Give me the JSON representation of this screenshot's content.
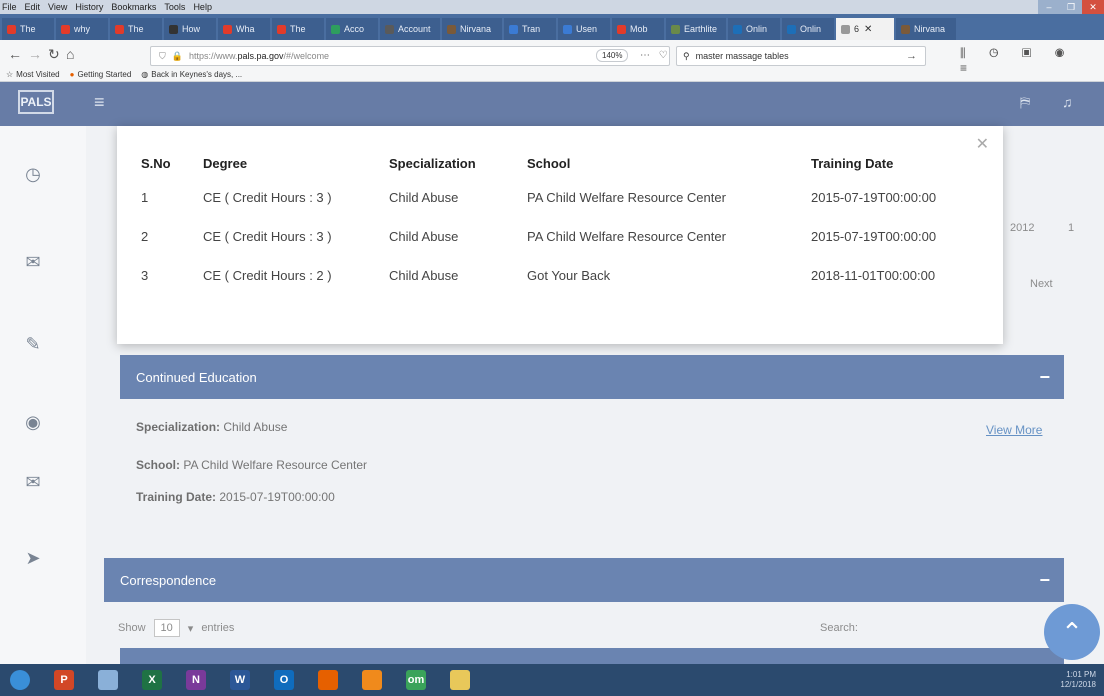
{
  "browser": {
    "menu": [
      "File",
      "Edit",
      "View",
      "History",
      "Bookmarks",
      "Tools",
      "Help"
    ],
    "tabs": [
      {
        "label": "The",
        "color": "#e23b2a"
      },
      {
        "label": "why",
        "color": "#e23b2a"
      },
      {
        "label": "The",
        "color": "#e23b2a"
      },
      {
        "label": "How",
        "color": "#333333"
      },
      {
        "label": "Wha",
        "color": "#e23b2a"
      },
      {
        "label": "The",
        "color": "#e23b2a"
      },
      {
        "label": "Acco",
        "color": "#2e9e5e"
      },
      {
        "label": "Account",
        "color": "#5a5a5a"
      },
      {
        "label": "Nirvana",
        "color": "#7a5a3a"
      },
      {
        "label": "Tran",
        "color": "#3b7bd4"
      },
      {
        "label": "Usen",
        "color": "#3b7bd4"
      },
      {
        "label": "Mob",
        "color": "#e23b2a"
      },
      {
        "label": "Earthlite",
        "color": "#6a8a4a"
      },
      {
        "label": "Onlin",
        "color": "#1d6fb8"
      },
      {
        "label": "Onlin",
        "color": "#1d6fb8"
      },
      {
        "label": "6",
        "color": "#999999",
        "active": true
      },
      {
        "label": "Nirvana",
        "color": "#7a5a3a"
      }
    ],
    "url_prefix": "https://www.",
    "url_domain": "pals.pa.gov",
    "url_suffix": "/#/welcome",
    "zoom": "140%",
    "search_value": "master massage tables",
    "bookmarks": [
      "Most Visited",
      "Getting Started",
      "Back in Keynes's days, ..."
    ]
  },
  "app": {
    "logo": "PALS",
    "sections": {
      "continued_education": "Continued Education",
      "correspondence": "Correspondence"
    },
    "detail": {
      "specialization_label": "Specialization:",
      "specialization_value": "Child Abuse",
      "school_label": "School:",
      "school_value": "PA Child Welfare Resource Center",
      "training_label": "Training Date:",
      "training_value": "2015-07-19T00:00:00",
      "view_more": "View More"
    },
    "bg_fragments": {
      "year": "2012",
      "num": "1",
      "next": "Next"
    },
    "table_controls": {
      "show": "Show",
      "count": "10",
      "entries": "entries",
      "search": "Search:"
    }
  },
  "modal": {
    "headers": [
      "S.No",
      "Degree",
      "Specialization",
      "School",
      "Training Date"
    ],
    "rows": [
      [
        "1",
        "CE ( Credit Hours : 3 )",
        "Child Abuse",
        "PA Child Welfare Resource Center",
        "2015-07-19T00:00:00"
      ],
      [
        "2",
        "CE ( Credit Hours : 3 )",
        "Child Abuse",
        "PA Child Welfare Resource Center",
        "2015-07-19T00:00:00"
      ],
      [
        "3",
        "CE ( Credit Hours : 2 )",
        "Child Abuse",
        "Got Your Back",
        "2018-11-01T00:00:00"
      ]
    ]
  },
  "taskbar": {
    "apps": [
      {
        "name": "start",
        "glyph": "",
        "color": "#3a8fd8"
      },
      {
        "name": "powerpoint",
        "glyph": "P",
        "color": "#d24726"
      },
      {
        "name": "files",
        "glyph": "",
        "color": "#8ab0d8"
      },
      {
        "name": "excel",
        "glyph": "X",
        "color": "#1f7244"
      },
      {
        "name": "onenote",
        "glyph": "N",
        "color": "#7a3a9a"
      },
      {
        "name": "word",
        "glyph": "W",
        "color": "#2b5797"
      },
      {
        "name": "outlook",
        "glyph": "O",
        "color": "#0f6cbd"
      },
      {
        "name": "firefox",
        "glyph": "",
        "color": "#e66000"
      },
      {
        "name": "media",
        "glyph": "",
        "color": "#f08a1c"
      },
      {
        "name": "om",
        "glyph": "om",
        "color": "#3aa35a"
      },
      {
        "name": "explorer",
        "glyph": "",
        "color": "#e8c85a"
      }
    ],
    "time": "1:01 PM",
    "date": "12/1/2018"
  }
}
